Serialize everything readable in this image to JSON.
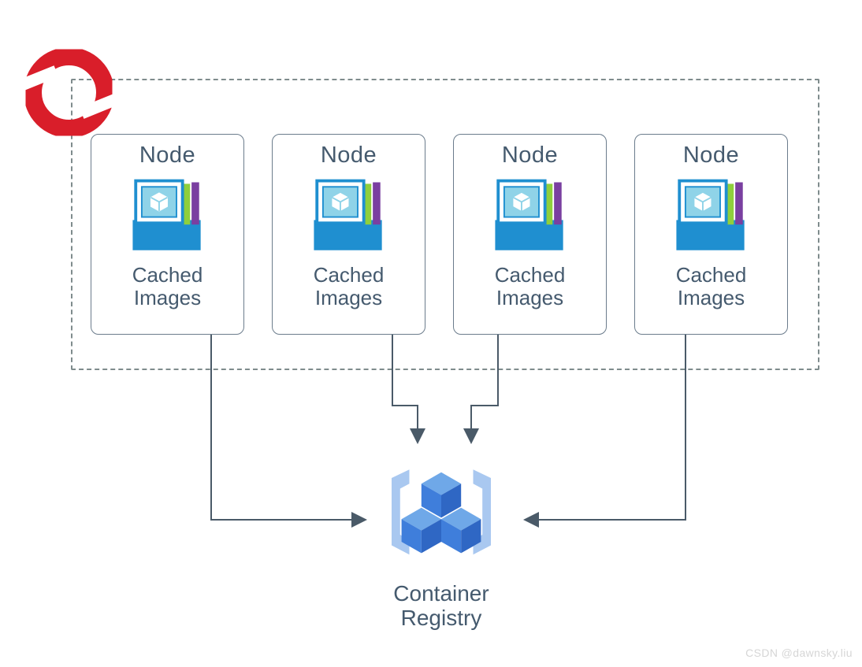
{
  "cluster": {
    "nodes": [
      {
        "title": "Node",
        "caption_line1": "Cached",
        "caption_line2": "Images"
      },
      {
        "title": "Node",
        "caption_line1": "Cached",
        "caption_line2": "Images"
      },
      {
        "title": "Node",
        "caption_line1": "Cached",
        "caption_line2": "Images"
      },
      {
        "title": "Node",
        "caption_line1": "Cached",
        "caption_line2": "Images"
      }
    ]
  },
  "registry": {
    "label_line1": "Container",
    "label_line2": "Registry"
  },
  "watermark": "CSDN @dawnsky.liu"
}
